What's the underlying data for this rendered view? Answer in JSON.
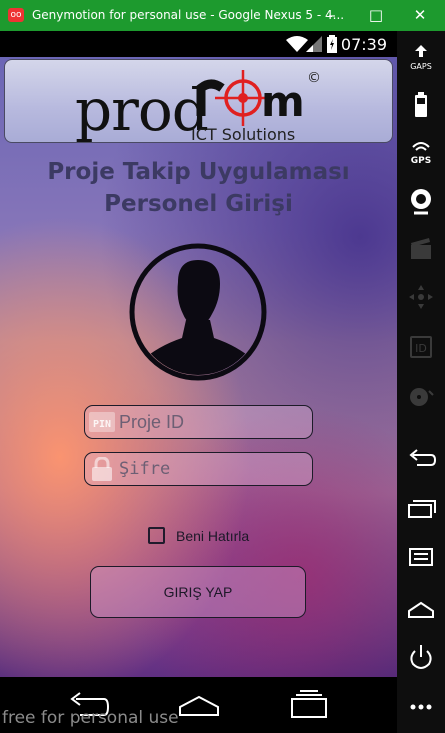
{
  "window": {
    "title": "Genymotion for personal use - Google Nexus 5 - 4...",
    "app_icon": "oo"
  },
  "statusbar": {
    "time": "07:39"
  },
  "logo": {
    "brand": "prodrom",
    "brand_pre": "prod",
    "brand_post": "m",
    "tagline": "ICT Solutions",
    "copyright": "©",
    "accent": "#e02020"
  },
  "heading": {
    "line1": "Proje Takip Uygulaması",
    "line2": "Personel Girişi"
  },
  "form": {
    "pin_placeholder": "Proje ID",
    "pin_icon_text": "PIN",
    "password_placeholder": "Şifre",
    "remember_label": "Beni Hatırla",
    "remember_checked": false,
    "login_label": "GIRIŞ YAP"
  },
  "watermark": "free for personal use",
  "sidebar": {
    "gaps_label": "GAPS",
    "gps_label": "GPS",
    "id_label": "ID"
  },
  "colors": {
    "titlebar": "#1d9a2e",
    "heading": "#3c3a63"
  }
}
